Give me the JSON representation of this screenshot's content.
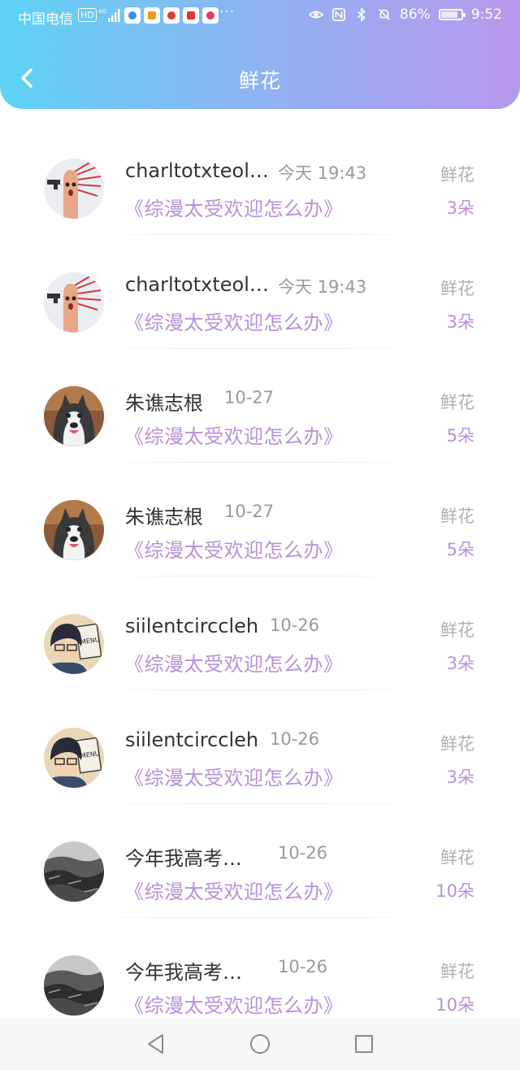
{
  "status_bar": {
    "carrier": "中国电信",
    "hd_badge": "HD",
    "network": "4G",
    "more": "···",
    "battery": "86%",
    "time": "9:52",
    "app_icons": [
      "baidu-netdisk-icon",
      "paper-plane-app-icon",
      "weibo-app-icon",
      "sunglasses-app-icon",
      "mail-app-icon"
    ],
    "right_icons": [
      "eye-comfort-icon",
      "nfc-icon",
      "bluetooth-icon",
      "mute-bell-icon"
    ]
  },
  "header": {
    "title": "鲜花",
    "back_icon": "chevron-left-icon",
    "gradient": [
      "#5ed3f5",
      "#b898ec"
    ]
  },
  "colors": {
    "accent": "#b891d8",
    "name": "#333333",
    "muted": "#9a9a9a"
  },
  "items": [
    {
      "name": "charltotxteol…",
      "time": "今天 19:43",
      "book": "《综漫太受欢迎怎么办》",
      "type": "鲜花",
      "count": "3朵",
      "avatar": "finger-avatar"
    },
    {
      "name": "charltotxteol…",
      "time": "今天 19:43",
      "book": "《综漫太受欢迎怎么办》",
      "type": "鲜花",
      "count": "3朵",
      "avatar": "finger-avatar"
    },
    {
      "name": "朱谯志根",
      "time": "10-27",
      "book": "《综漫太受欢迎怎么办》",
      "type": "鲜花",
      "count": "5朵",
      "avatar": "husky-avatar"
    },
    {
      "name": "朱谯志根",
      "time": "10-27",
      "book": "《综漫太受欢迎怎么办》",
      "type": "鲜花",
      "count": "5朵",
      "avatar": "husky-avatar"
    },
    {
      "name": "siilentcirccleh",
      "time": "10-26",
      "book": "《综漫太受欢迎怎么办》",
      "type": "鲜花",
      "count": "3朵",
      "avatar": "anime-boy-avatar"
    },
    {
      "name": "siilentcirccleh",
      "time": "10-26",
      "book": "《综漫太受欢迎怎么办》",
      "type": "鲜花",
      "count": "3朵",
      "avatar": "anime-boy-avatar"
    },
    {
      "name": "今年我高考…",
      "time": "10-26",
      "book": "《综漫太受欢迎怎么办》",
      "type": "鲜花",
      "count": "10朵",
      "avatar": "landscape-avatar"
    },
    {
      "name": "今年我高考…",
      "time": "10-26",
      "book": "《综漫太受欢迎怎么办》",
      "type": "鲜花",
      "count": "10朵",
      "avatar": "landscape-avatar"
    }
  ],
  "nav": {
    "back": "triangle-back-icon",
    "home": "circle-home-icon",
    "recents": "square-recents-icon"
  }
}
